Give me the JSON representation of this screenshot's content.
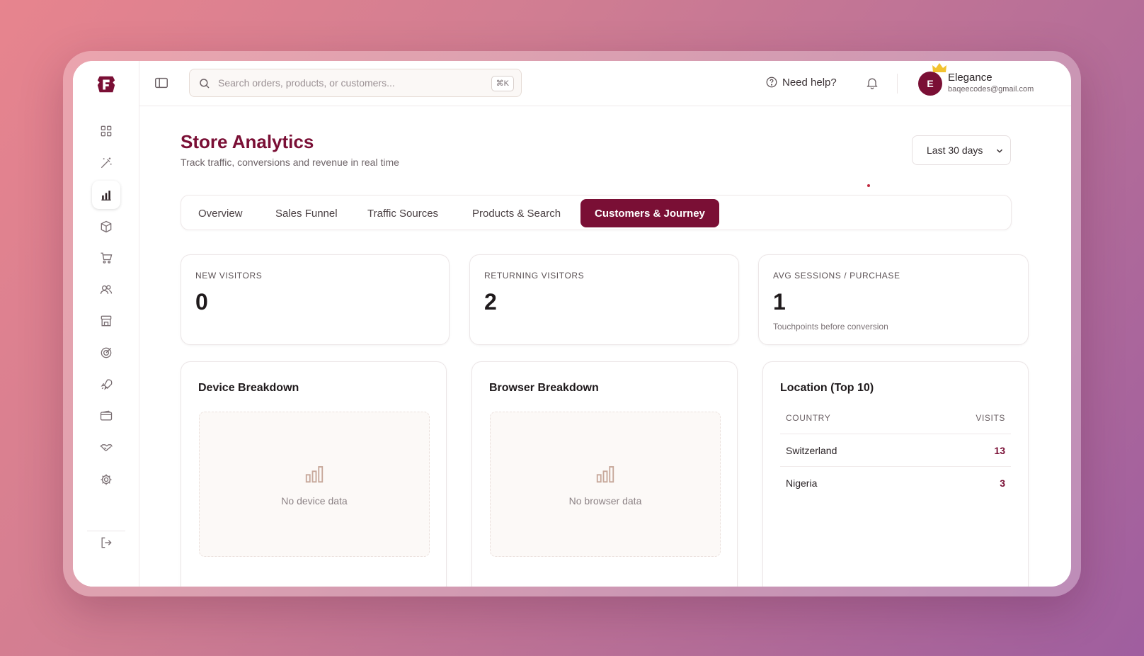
{
  "colors": {
    "accent": "#7a0f35",
    "background_gradient_start": "#e7848e",
    "background_gradient_end": "#9f5e9f"
  },
  "sidebar": {
    "items": [
      {
        "icon": "grid-icon"
      },
      {
        "icon": "magic-wand-icon"
      },
      {
        "icon": "bar-chart-icon",
        "active": true
      },
      {
        "icon": "box-icon"
      },
      {
        "icon": "cart-icon"
      },
      {
        "icon": "users-icon"
      },
      {
        "icon": "store-icon"
      },
      {
        "icon": "target-icon"
      },
      {
        "icon": "rocket-icon"
      },
      {
        "icon": "wallet-icon"
      },
      {
        "icon": "handshake-icon"
      },
      {
        "icon": "settings-icon"
      }
    ],
    "logout_icon": "logout-icon"
  },
  "topbar": {
    "search_placeholder": "Search orders, products, or customers...",
    "search_shortcut": "⌘K",
    "help_label": "Need help?",
    "user": {
      "initial": "E",
      "name": "Elegance",
      "email": "baqeecodes@gmail.com"
    }
  },
  "page": {
    "title": "Store Analytics",
    "subtitle": "Track traffic, conversions and revenue in real time",
    "date_range": "Last 30 days"
  },
  "tabs": [
    {
      "label": "Overview"
    },
    {
      "label": "Sales Funnel"
    },
    {
      "label": "Traffic Sources"
    },
    {
      "label": "Products & Search"
    },
    {
      "label": "Customers & Journey",
      "active": true
    }
  ],
  "stats": [
    {
      "label": "NEW VISITORS",
      "value": "0"
    },
    {
      "label": "RETURNING VISITORS",
      "value": "2"
    },
    {
      "label": "AVG SESSIONS / PURCHASE",
      "value": "1",
      "note": "Touchpoints before conversion"
    }
  ],
  "device_panel": {
    "title": "Device Breakdown",
    "empty_text": "No device data"
  },
  "browser_panel": {
    "title": "Browser Breakdown",
    "empty_text": "No browser data"
  },
  "location_panel": {
    "title": "Location (Top 10)",
    "columns": [
      "COUNTRY",
      "VISITS"
    ],
    "rows": [
      {
        "country": "Switzerland",
        "visits": "13"
      },
      {
        "country": "Nigeria",
        "visits": "3"
      }
    ]
  }
}
